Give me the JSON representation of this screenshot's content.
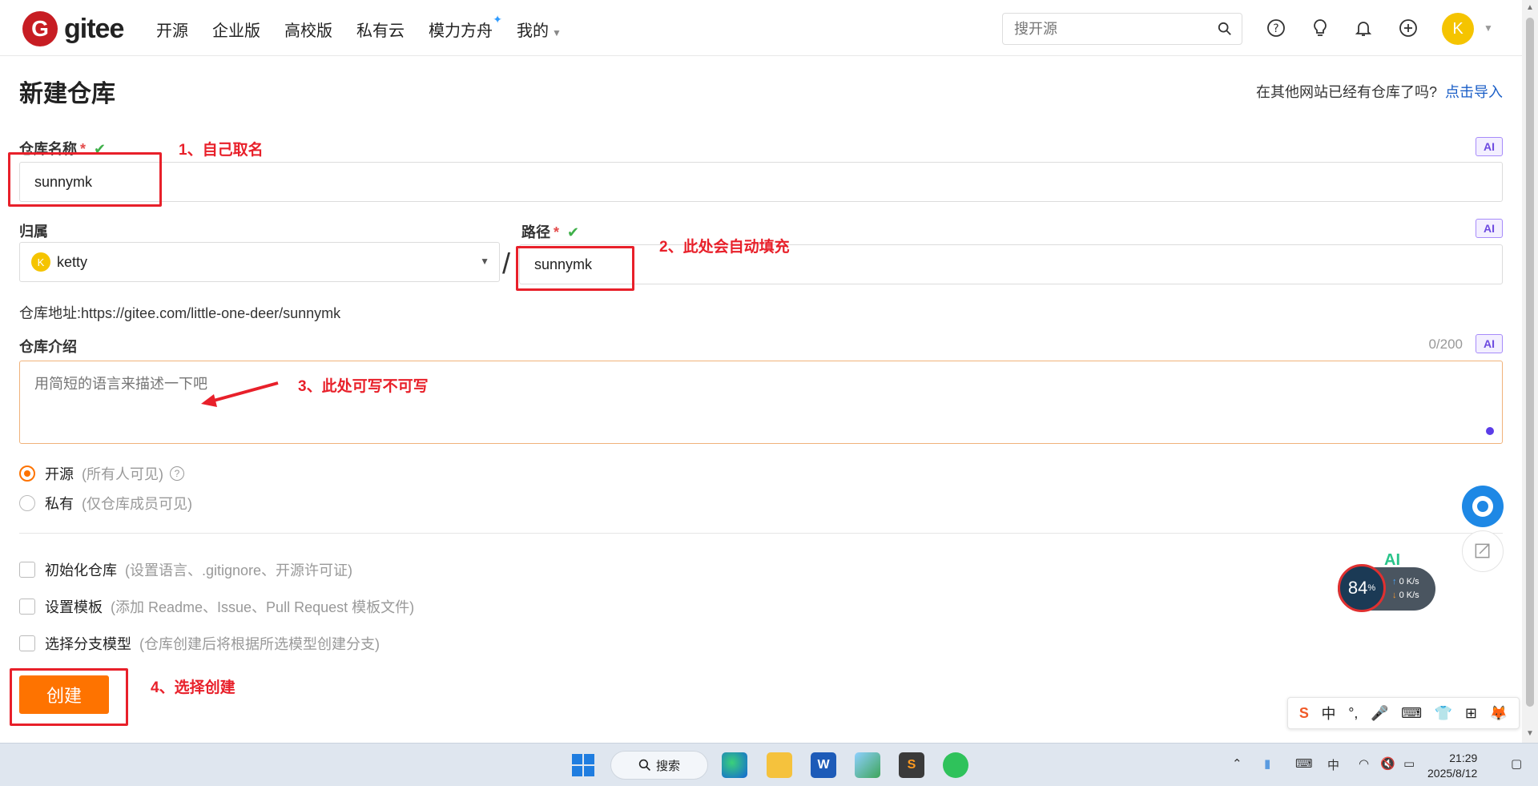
{
  "nav": {
    "logo_letter": "G",
    "logo_text": "gitee",
    "links": [
      "开源",
      "企业版",
      "高校版",
      "私有云",
      "模力方舟",
      "我的"
    ],
    "search_placeholder": "搜开源",
    "avatar_letter": "K"
  },
  "page": {
    "title": "新建仓库",
    "import_prompt": "在其他网站已经有仓库了吗?",
    "import_link": "点击导入"
  },
  "form": {
    "name_label": "仓库名称",
    "name_value": "sunnymk",
    "owner_label": "归属",
    "owner_value": "ketty",
    "owner_avatar": "K",
    "path_label": "路径",
    "path_value": "sunnymk",
    "slash": "/",
    "address_label": "仓库地址:",
    "address_value": "https://gitee.com/little-one-deer/sunnymk",
    "desc_label": "仓库介绍",
    "desc_placeholder": "用简短的语言来描述一下吧",
    "desc_counter": "0/200",
    "required_mark": "*",
    "ok_mark": "✔",
    "ai_label": "AI"
  },
  "visibility": [
    {
      "label": "开源",
      "hint": "(所有人可见)",
      "selected": true
    },
    {
      "label": "私有",
      "hint": "(仅仓库成员可见)",
      "selected": false
    }
  ],
  "options": [
    {
      "label": "初始化仓库",
      "hint": "(设置语言、.gitignore、开源许可证)"
    },
    {
      "label": "设置模板",
      "hint": "(添加 Readme、Issue、Pull Request 模板文件)"
    },
    {
      "label": "选择分支模型",
      "hint": "(仓库创建后将根据所选模型创建分支)"
    }
  ],
  "create_button": "创建",
  "annotations": {
    "a1": "1、自己取名",
    "a2": "2、此处会自动填充",
    "a3": "3、此处可写不可写",
    "a4": "4、选择创建"
  },
  "widgets": {
    "speed_percent": "84",
    "speed_unit": "%",
    "upload": "0 K/s",
    "download": "0 K/s",
    "ai_text": "AI",
    "ime_items": [
      "S",
      "中",
      "°,",
      "🎤",
      "⌨",
      "👕",
      "⊞",
      "🦊"
    ]
  },
  "taskbar": {
    "search_label": "搜索",
    "time": "21:29",
    "date": "2025/8/12"
  },
  "colors": {
    "brand_red": "#c71d23",
    "accent_orange": "#fe7300",
    "link_blue": "#1a5ec7",
    "annotation_red": "#e8202a"
  }
}
